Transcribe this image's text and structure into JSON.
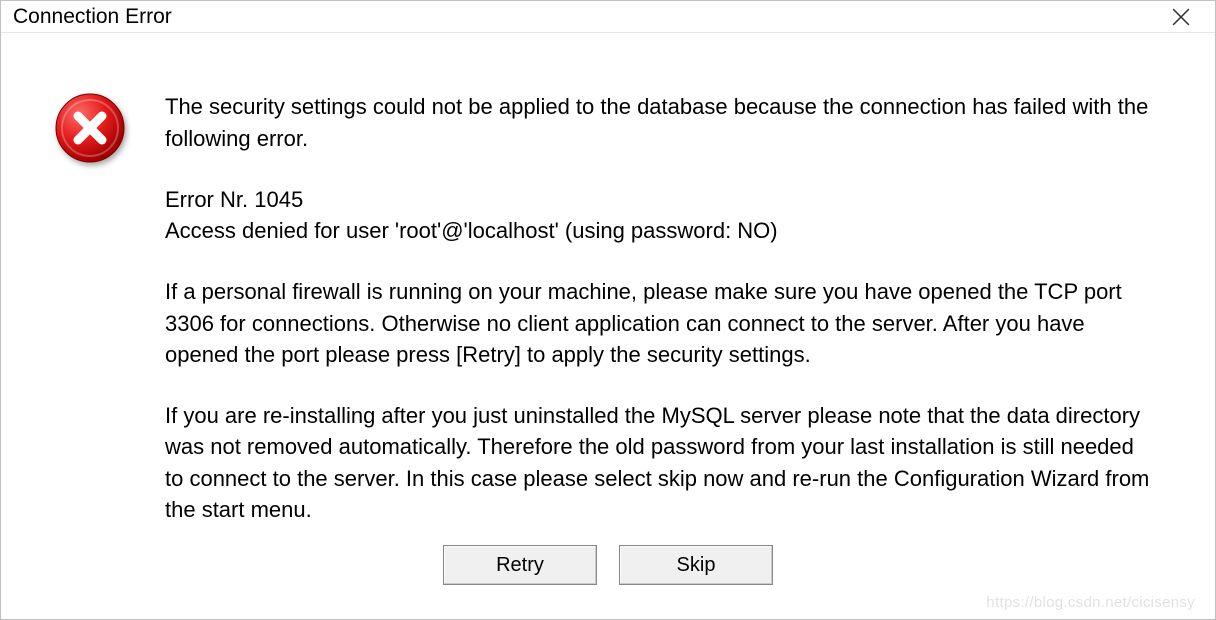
{
  "titlebar": {
    "title": "Connection Error"
  },
  "icon": {
    "name": "error-icon"
  },
  "message": {
    "intro": "The security settings could not be applied to the database because the connection has failed with the following error.",
    "error_nr_label": "Error Nr.",
    "error_nr": "1045",
    "error_detail": "Access denied for user 'root'@'localhost' (using password: NO)",
    "firewall_hint": "If a personal firewall is running on your machine, please make sure you have opened the TCP port 3306 for connections. Otherwise no client application can connect to the server. After you have opened the port please press [Retry] to apply the security settings.",
    "reinstall_hint": "If you are re-installing after you just uninstalled the MySQL server please note that the data directory was not removed automatically. Therefore the old password from your last installation is still needed to connect to the server. In this case please select skip now and re-run the Configuration Wizard from the start menu."
  },
  "buttons": {
    "retry": "Retry",
    "skip": "Skip"
  },
  "watermark": "https://blog.csdn.net/cicisensy"
}
